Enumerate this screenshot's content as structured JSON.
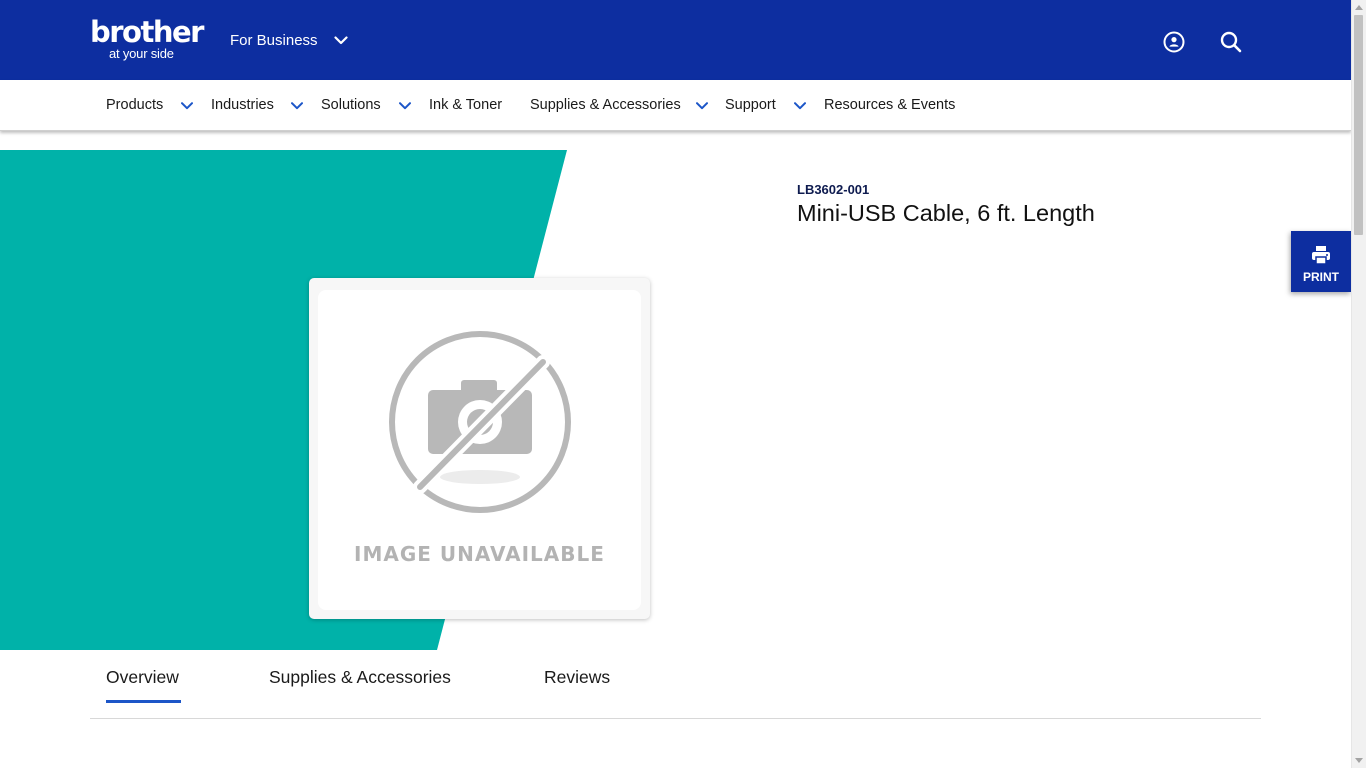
{
  "header": {
    "logo_main": "brother",
    "logo_sub": "at your side",
    "segment_label": "For Business",
    "icons": [
      "account-icon",
      "search-icon"
    ]
  },
  "nav": {
    "items": [
      {
        "label": "Products",
        "has_dropdown": true
      },
      {
        "label": "Industries",
        "has_dropdown": true
      },
      {
        "label": "Solutions",
        "has_dropdown": true
      },
      {
        "label": "Ink & Toner",
        "has_dropdown": false
      },
      {
        "label": "Supplies & Accessories",
        "has_dropdown": true
      },
      {
        "label": "Support",
        "has_dropdown": true
      },
      {
        "label": "Resources & Events",
        "has_dropdown": false
      }
    ]
  },
  "product": {
    "sku": "LB3602-001",
    "title": "Mini-USB Cable, 6 ft. Length",
    "image_placeholder_text": "IMAGE UNAVAILABLE"
  },
  "print_button": {
    "label": "PRINT",
    "icon": "printer-icon"
  },
  "tabs": {
    "items": [
      {
        "label": "Overview",
        "active": true
      },
      {
        "label": "Supplies & Accessories",
        "active": false
      },
      {
        "label": "Reviews",
        "active": false
      }
    ]
  },
  "colors": {
    "header_blue": "#0d2ea0",
    "teal": "#00b2a9",
    "tab_accent": "#1c56c8",
    "placeholder_gray": "#b3b3b3"
  }
}
